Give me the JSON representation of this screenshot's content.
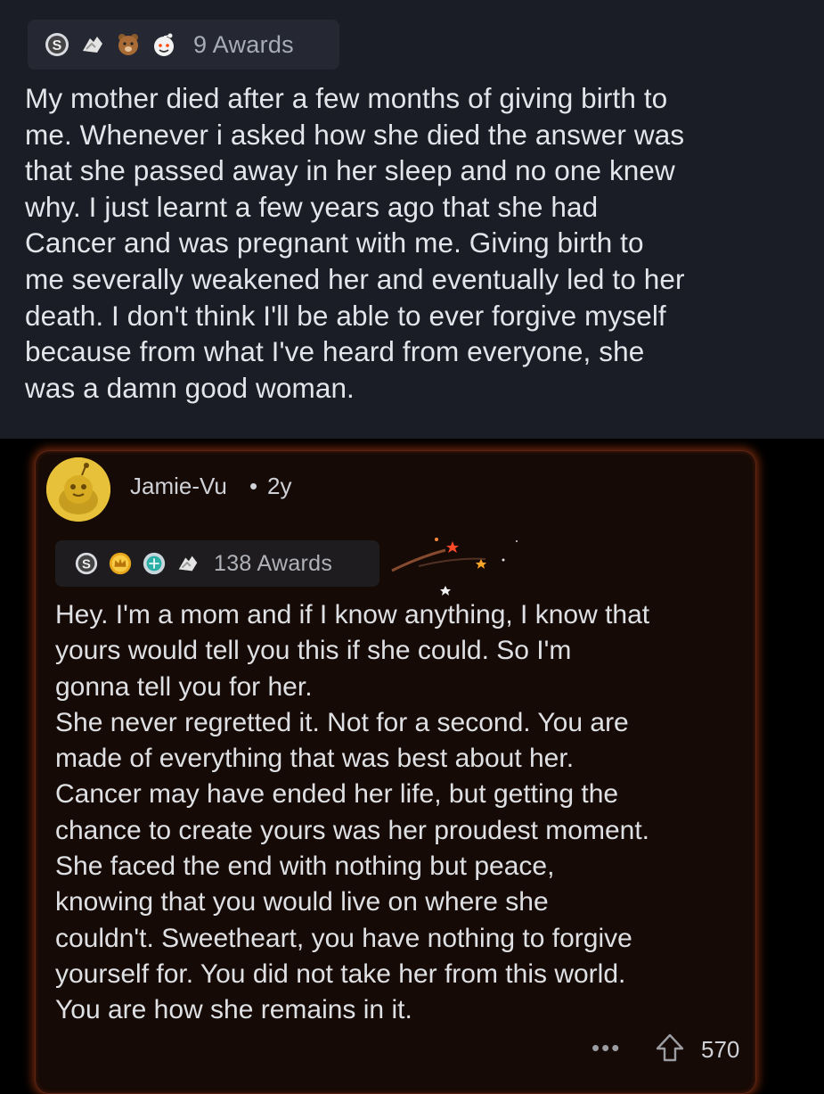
{
  "post": {
    "awards": {
      "icons": [
        "silver-award-icon",
        "hands-award-icon",
        "bear-award-icon",
        "wholesome-award-icon"
      ],
      "count_label": "9 Awards"
    },
    "body": "My mother died after a few months of giving birth to\nme. Whenever i asked how she died the answer was\nthat she passed away in her sleep and no one knew\nwhy. I just learnt a few years ago that she had\nCancer and was pregnant with me. Giving birth to\nme severally weakened her and eventually led to her\ndeath. I don't think I'll be able to ever forgive myself\nbecause from what I've heard from everyone, she\nwas a damn good woman."
  },
  "comment": {
    "username": "Jamie-Vu",
    "separator": "•",
    "age": "2y",
    "awards": {
      "icons": [
        "silver-award-icon",
        "gold-crown-award-icon",
        "platinum-award-icon",
        "hands-award-icon"
      ],
      "count_label": "138 Awards"
    },
    "body": "Hey. I'm a mom and if I know anything, I know that\nyours would tell you this if she could. So I'm\ngonna tell you for her.\nShe never regretted it. Not for a second. You are\nmade of everything that was best about her.\nCancer may have ended her life, but getting the\nchance to create yours was her proudest moment.\nShe faced the end with nothing but peace,\nknowing that you would live on where she\ncouldn't. Sweetheart, you have nothing to forgive\nyourself for.  You did not take her from this world.\nYou are how she remains in it.",
    "more_label": "•••",
    "vote_count": "570"
  },
  "colors": {
    "post_bg": "#1a1d26",
    "comment_bg": "#150a06",
    "comment_glow": "#c8461a",
    "avatar_bg": "#e8c13a"
  }
}
